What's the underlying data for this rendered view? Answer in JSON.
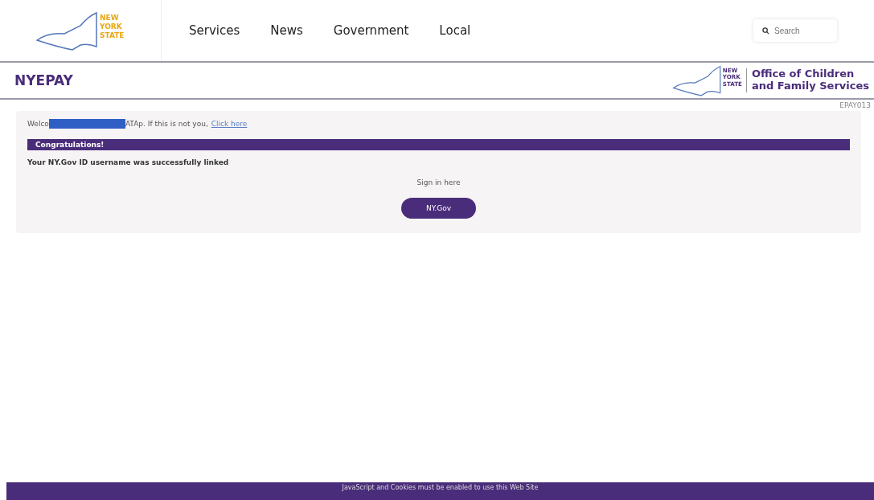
{
  "logo": {
    "lines": [
      "NEW",
      "YORK",
      "STATE"
    ]
  },
  "nav": [
    {
      "label": "Services"
    },
    {
      "label": "News"
    },
    {
      "label": "Government"
    },
    {
      "label": "Local"
    }
  ],
  "search": {
    "placeholder": "Search"
  },
  "app_bar": {
    "title": "NYEPAY",
    "agency_logo": [
      "NEW",
      "YORK",
      "STATE"
    ],
    "agency_name": "Office of Children and Family Services"
  },
  "page_code": "EPAY013",
  "welcome": {
    "before": "Welco",
    "redacted": true,
    "after": "ATAp. If this is not you,",
    "link": "Click here"
  },
  "banner": "Congratulations!",
  "message": "Your NY.Gov ID username was successfully linked",
  "sign_in_label": "Sign in here",
  "sign_in_button": "NY.Gov",
  "footer": "JavaScript and Cookies must be enabled to use this Web Site"
}
